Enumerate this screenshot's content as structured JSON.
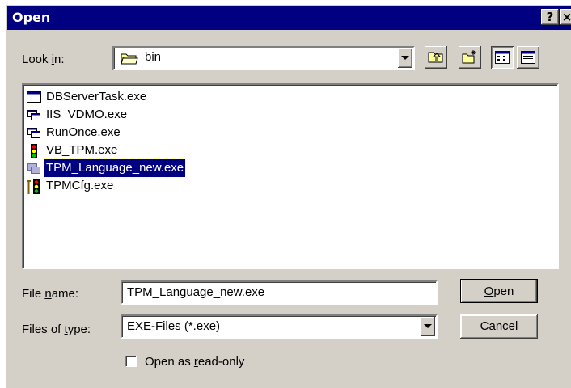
{
  "window": {
    "title": "Open",
    "help_label": "?",
    "close_label": "×"
  },
  "look_in": {
    "label_pre": "Look ",
    "label_mnemonic": "i",
    "label_post": "n:",
    "value": "bin",
    "icon": "folder-icon"
  },
  "toolbar": {
    "up_one_level": "up-folder-icon",
    "create_new_folder": "new-folder-icon",
    "list_view": "list-view-icon",
    "details_view": "details-view-icon"
  },
  "files": [
    {
      "name": "DBServerTask.exe",
      "icon": "window-app-icon"
    },
    {
      "name": "IIS_VDMO.exe",
      "icon": "app-icon"
    },
    {
      "name": "RunOnce.exe",
      "icon": "app-icon"
    },
    {
      "name": "VB_TPM.exe",
      "icon": "traffic-light-icon"
    },
    {
      "name": "TPM_Language_new.exe",
      "icon": "app-icon",
      "selected": true
    },
    {
      "name": "TPMCfg.exe",
      "icon": "traffic-light-tools-icon"
    }
  ],
  "file_name": {
    "label_pre": "File ",
    "label_mnemonic": "n",
    "label_post": "ame:",
    "value": "TPM_Language_new.exe"
  },
  "file_type": {
    "label_pre": "Files of ",
    "label_mnemonic": "t",
    "label_post": "ype:",
    "value": "EXE-Files (*.exe)"
  },
  "buttons": {
    "open_mnemonic": "O",
    "open_rest": "pen",
    "cancel": "Cancel"
  },
  "read_only": {
    "label_pre": "Open as ",
    "label_mnemonic": "r",
    "label_post": "ead-only",
    "checked": false
  }
}
